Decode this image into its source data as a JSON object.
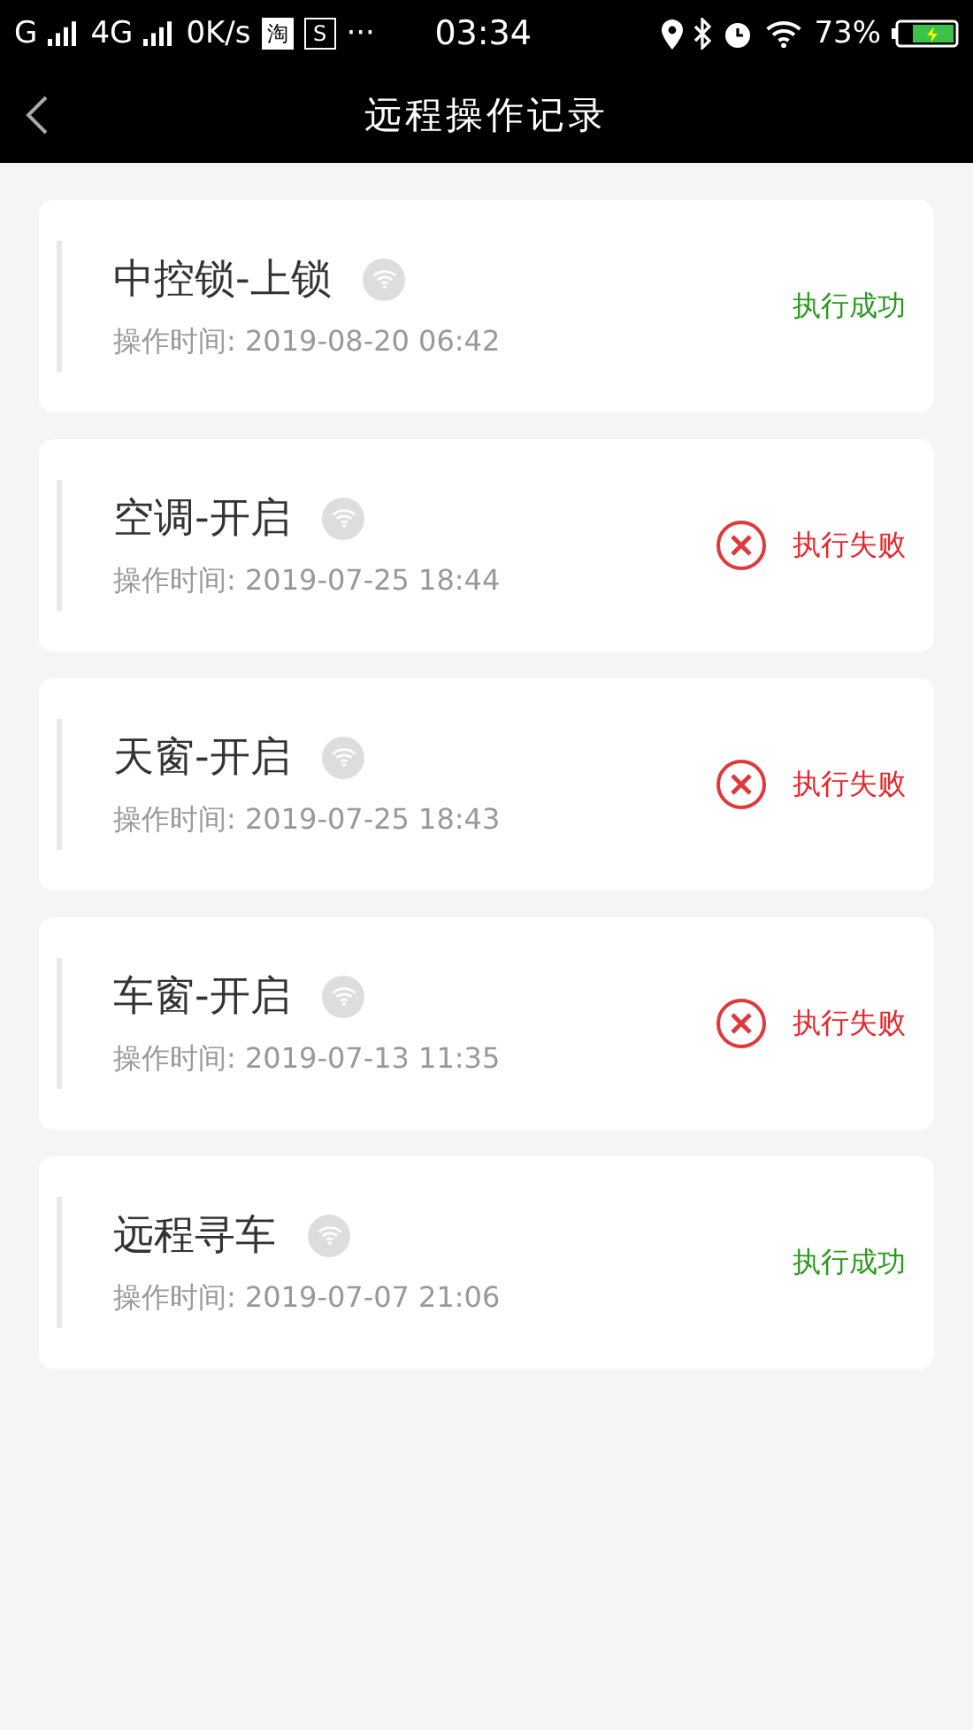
{
  "status_bar": {
    "carrier_1": "G",
    "carrier_2": "4G",
    "speed": "0K/s",
    "notifications": [
      "淘",
      "S"
    ],
    "more": "···",
    "time": "03:34",
    "battery": "73%"
  },
  "nav": {
    "title": "远程操作记录"
  },
  "records": [
    {
      "title": "中控锁-上锁",
      "time": "操作时间: 2019-08-20 06:42",
      "result": "执行成功",
      "kind": "success"
    },
    {
      "title": "空调-开启",
      "time": "操作时间: 2019-07-25 18:44",
      "result": "执行失败",
      "kind": "failure"
    },
    {
      "title": "天窗-开启",
      "time": "操作时间: 2019-07-25 18:43",
      "result": "执行失败",
      "kind": "failure"
    },
    {
      "title": "车窗-开启",
      "time": "操作时间: 2019-07-13 11:35",
      "result": "执行失败",
      "kind": "failure"
    },
    {
      "title": "远程寻车",
      "time": "操作时间: 2019-07-07 21:06",
      "result": "执行成功",
      "kind": "success"
    }
  ]
}
